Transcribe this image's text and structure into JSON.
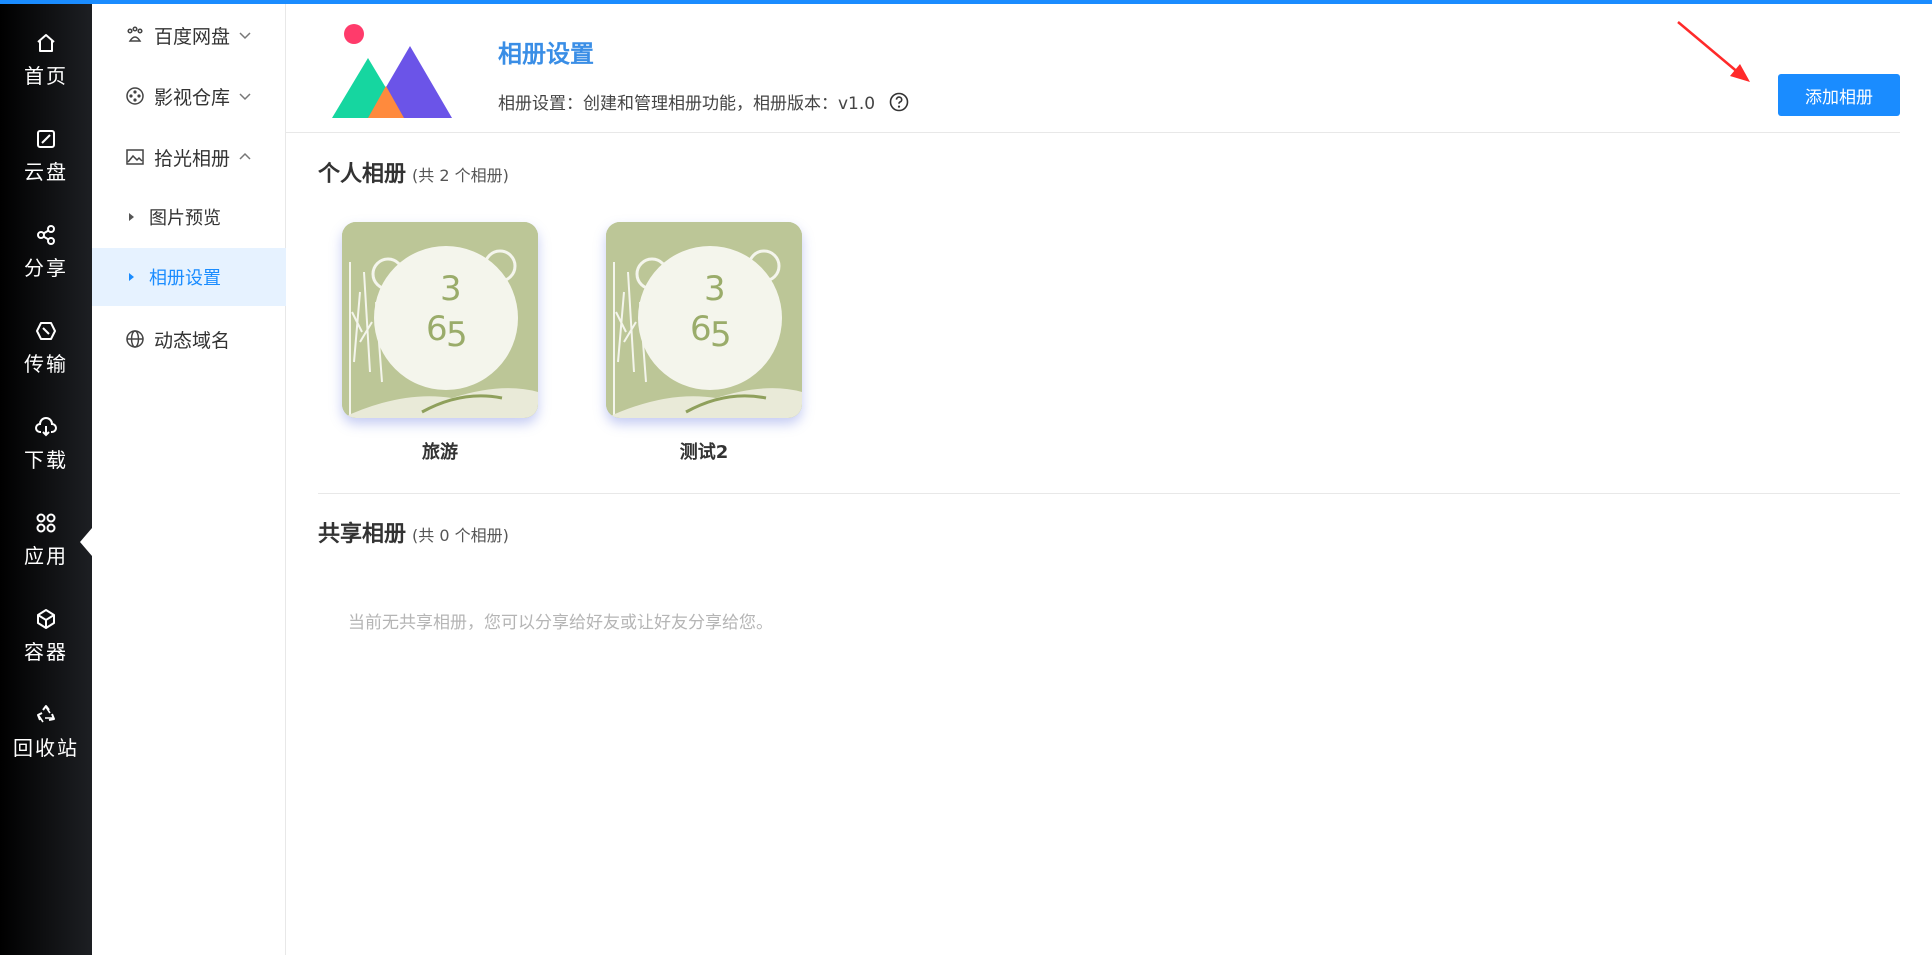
{
  "rail": {
    "items": [
      {
        "label": "首页",
        "icon": "home-icon"
      },
      {
        "label": "云盘",
        "icon": "cloud-disk-icon"
      },
      {
        "label": "分享",
        "icon": "share-icon"
      },
      {
        "label": "传输",
        "icon": "transfer-icon"
      },
      {
        "label": "下载",
        "icon": "download-icon"
      },
      {
        "label": "应用",
        "icon": "apps-icon"
      },
      {
        "label": "容器",
        "icon": "container-icon"
      },
      {
        "label": "回收站",
        "icon": "recycle-icon"
      }
    ],
    "active": "应用"
  },
  "submenu": {
    "items": [
      {
        "label": "百度网盘",
        "icon": "paw-icon",
        "expanded": false
      },
      {
        "label": "影视仓库",
        "icon": "film-reel-icon",
        "expanded": false
      },
      {
        "label": "拾光相册",
        "icon": "image-icon",
        "expanded": true
      },
      {
        "label": "动态域名",
        "icon": "globe-icon"
      }
    ],
    "children": [
      {
        "label": "图片预览"
      },
      {
        "label": "相册设置"
      }
    ],
    "active_child": "相册设置"
  },
  "header": {
    "title": "相册设置",
    "description": "相册设置：创建和管理相册功能，相册版本：v1.0",
    "add_button": "添加相册"
  },
  "personal": {
    "title": "个人相册",
    "count_text": "(共 2 个相册)",
    "albums": [
      {
        "name": "旅游"
      },
      {
        "name": "测试2"
      }
    ]
  },
  "shared": {
    "title": "共享相册",
    "count_text": "(共 0 个相册)",
    "empty_message": "当前无共享相册，您可以分享给好友或让好友分享给您。"
  },
  "colors": {
    "accent": "#1a8cff",
    "title_blue": "#3a8ee6",
    "rail_bg": "#1d1f23",
    "active_bg": "#e6f2ff",
    "cover_green": "#bcc697",
    "arrow_red": "#ff2a2a"
  }
}
